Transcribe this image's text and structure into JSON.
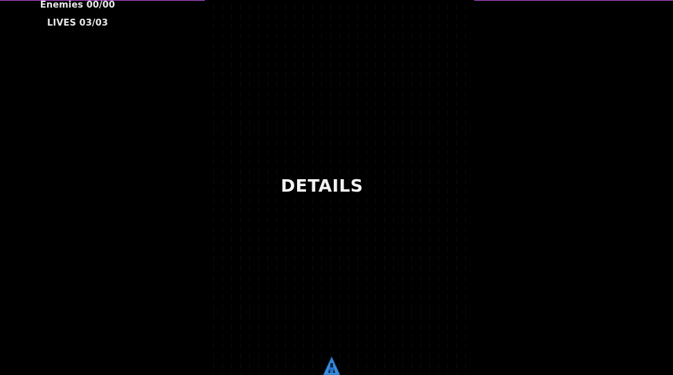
{
  "hud": {
    "enemies_text": "Enemies 00/00",
    "lives_text": "LIVES 03/03"
  },
  "overlay": {
    "title": "DETAILS"
  },
  "colors": {
    "background": "#000000",
    "hud_text": "#e8e8e8",
    "border_accent": "#b04ad0",
    "ship_blue": "#3a8ee0"
  },
  "icons": {
    "player": "spaceship-icon"
  }
}
